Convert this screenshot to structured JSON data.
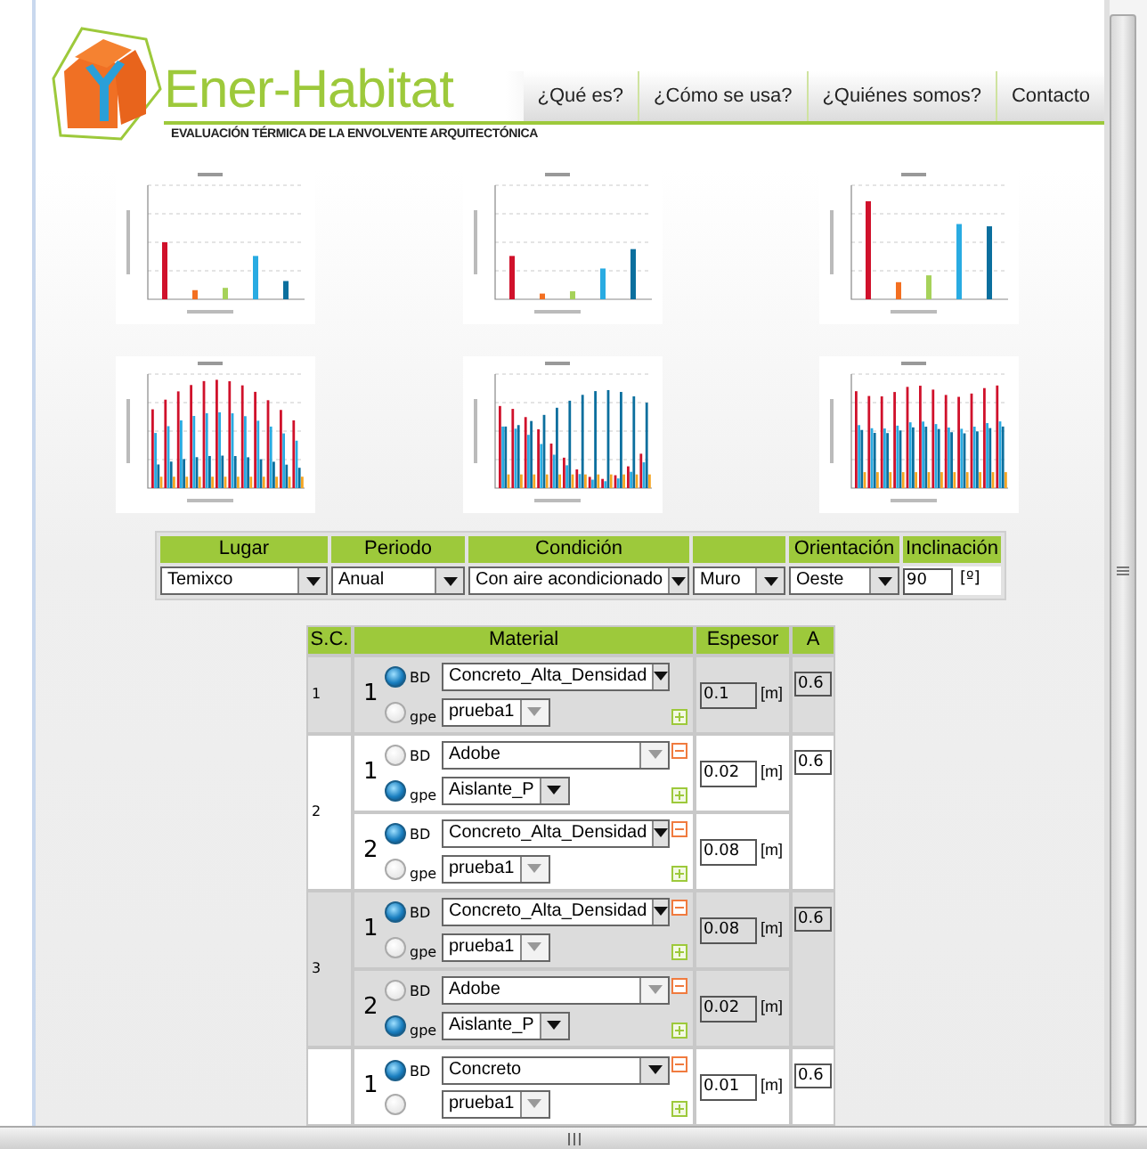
{
  "header": {
    "brand": "Ener-Habitat",
    "tagline": "EVALUACIÓN TÉRMICA DE LA ENVOLVENTE ARQUITECTÓNICA",
    "nav": [
      {
        "label": "¿Qué es?"
      },
      {
        "label": "¿Cómo se usa?"
      },
      {
        "label": "¿Quiénes somos?"
      },
      {
        "label": "Contacto"
      }
    ]
  },
  "parameters": [
    {
      "kind": "select",
      "heading": "Lugar",
      "value": "Temixco"
    },
    {
      "kind": "select",
      "heading": "Periodo",
      "value": "Anual"
    },
    {
      "kind": "select",
      "heading": "Condición",
      "value": "Con aire acondicionado"
    },
    {
      "kind": "select",
      "value": "Muro"
    },
    {
      "kind": "select",
      "heading": "Orientación",
      "value": "Oeste"
    },
    {
      "kind": "input",
      "heading": "Inclinación",
      "value": "90",
      "unit": "[º]"
    }
  ],
  "layers_table": {
    "columns": [
      "S.C.",
      "Material",
      "Espesor",
      "A"
    ],
    "layers": [
      {
        "sc": "1",
        "highlighted": true,
        "a": "0.6",
        "materials": [
          {
            "index": "1",
            "removable": false,
            "thickness": "0.1",
            "unit": "[m]",
            "sources": [
              {
                "label": "BD",
                "selected": true,
                "value": "Concreto_Alta_Densidad"
              },
              {
                "label": "gpe",
                "selected": false,
                "value": "prueba1"
              }
            ]
          }
        ]
      },
      {
        "sc": "2",
        "highlighted": false,
        "a": "0.6",
        "materials": [
          {
            "index": "1",
            "removable": true,
            "thickness": "0.02",
            "unit": "[m]",
            "sources": [
              {
                "label": "BD",
                "selected": false,
                "value": "Adobe"
              },
              {
                "label": "gpe",
                "selected": true,
                "value": "Aislante_P"
              }
            ]
          },
          {
            "index": "2",
            "removable": true,
            "thickness": "0.08",
            "unit": "[m]",
            "sources": [
              {
                "label": "BD",
                "selected": true,
                "value": "Concreto_Alta_Densidad"
              },
              {
                "label": "gpe",
                "selected": false,
                "value": "prueba1"
              }
            ]
          }
        ]
      },
      {
        "sc": "3",
        "highlighted": true,
        "a": "0.6",
        "materials": [
          {
            "index": "1",
            "removable": true,
            "thickness": "0.08",
            "unit": "[m]",
            "sources": [
              {
                "label": "BD",
                "selected": true,
                "value": "Concreto_Alta_Densidad"
              },
              {
                "label": "gpe",
                "selected": false,
                "value": "prueba1"
              }
            ]
          },
          {
            "index": "2",
            "removable": true,
            "thickness": "0.02",
            "unit": "[m]",
            "sources": [
              {
                "label": "BD",
                "selected": false,
                "value": "Adobe"
              },
              {
                "label": "gpe",
                "selected": true,
                "value": "Aislante_P"
              }
            ]
          }
        ]
      },
      {
        "highlighted": false,
        "a": "0.6",
        "materials": [
          {
            "index": "1",
            "removable": true,
            "thickness": "0.01",
            "unit": "[m]",
            "sources": [
              {
                "label": "BD",
                "selected": true,
                "value": "Concreto"
              },
              {
                "selected": false,
                "value": "prueba1"
              }
            ]
          }
        ]
      }
    ]
  }
}
